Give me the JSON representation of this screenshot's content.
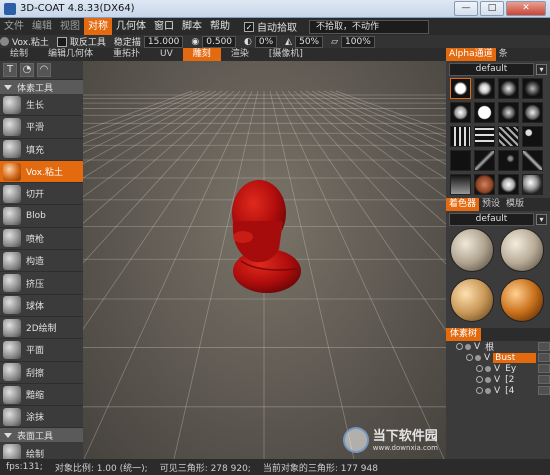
{
  "window": {
    "title": "3D-COAT 4.8.33(DX64)",
    "buttons": {
      "minimize": "—",
      "maximize": "□",
      "close": "✕"
    }
  },
  "menubar": {
    "items": [
      "文件",
      "编辑",
      "视图",
      "对称",
      "几何体",
      "窗口",
      "脚本",
      "帮助"
    ],
    "active_index": 3,
    "auto_pick_label": "自动拾取",
    "pick_dropdown": "不拾取，不动作"
  },
  "options": {
    "tool_name": "Vox.粘土",
    "depth_tool": "取反工具",
    "stabilize_label": "稳定描",
    "stabilize_value": "15.000",
    "radius_value": "0.500",
    "smooth_value": "0%",
    "depth_value": "50%",
    "plane_value": "100%"
  },
  "rooms": {
    "items": [
      "绘制",
      "编辑几何体",
      "重拓扑",
      "UV",
      "雕刻",
      "渲染",
      "[摄像机]"
    ],
    "active_index": 4
  },
  "left_panel": {
    "voxel_header": "体素工具",
    "tools": [
      "生长",
      "平滑",
      "填充",
      "Vox.粘土",
      "切开",
      "Blob",
      "喷枪",
      "构造",
      "挤压",
      "球体",
      "2D绘制",
      "平面",
      "刮擦",
      "黯缩",
      "涂抹"
    ],
    "selected_tool_index": 3,
    "surface_header": "表面工具",
    "surface_tools": [
      "绘制"
    ]
  },
  "right_panel": {
    "alpha_tab": "Alpha通道",
    "alpha_tab_extra": "条",
    "alpha_preset": "default",
    "material_tabs": [
      "着色器",
      "预设",
      "模版"
    ],
    "material_preset": "default",
    "layers_title": "体素树",
    "layers": [
      {
        "indent": 0,
        "name": "根",
        "highlight": false
      },
      {
        "indent": 1,
        "name": "Bust",
        "highlight": true
      },
      {
        "indent": 2,
        "name": "Ey",
        "highlight": false
      },
      {
        "indent": 2,
        "name": "[2",
        "highlight": false
      },
      {
        "indent": 2,
        "name": "[4",
        "highlight": false
      }
    ],
    "layer_v": "V"
  },
  "status": {
    "fps": "fps:131;",
    "scale": "对象比例: 1.00 (统一);",
    "visible_tris": "可见三角形: 278 920;",
    "current_tris": "当前对象的三角形: 177 948"
  },
  "watermark": {
    "title": "当下软件园",
    "url": "www.downxia.com"
  },
  "colors": {
    "accent": "#e46a10",
    "model": "#c01010"
  }
}
